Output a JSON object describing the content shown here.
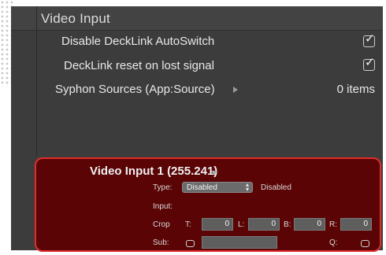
{
  "section": {
    "title": "Video Input"
  },
  "settings": [
    {
      "label": "Disable DeckLink AutoSwitch",
      "checked": true
    },
    {
      "label": "DeckLink reset on lost signal",
      "checked": true
    }
  ],
  "syphon": {
    "label": "Syphon Sources (App:Source)",
    "count": "0 items"
  },
  "video_input_1": {
    "title": "Video Input 1 (255.241)",
    "type_label": "Type:",
    "type_value": "Disabled",
    "type_status": "Disabled",
    "input_label": "Input:",
    "crop_label": "Crop",
    "crop": [
      {
        "label": "T:",
        "value": "0"
      },
      {
        "label": "L:",
        "value": "0"
      },
      {
        "label": "B:",
        "value": "0"
      },
      {
        "label": "R:",
        "value": "0"
      }
    ],
    "sub_label": "Sub:",
    "q_label": "Q:"
  },
  "colors": {
    "panel": "#3c3c3c",
    "highlight_fill": "#5a0405",
    "highlight_border": "#e22d2d"
  }
}
